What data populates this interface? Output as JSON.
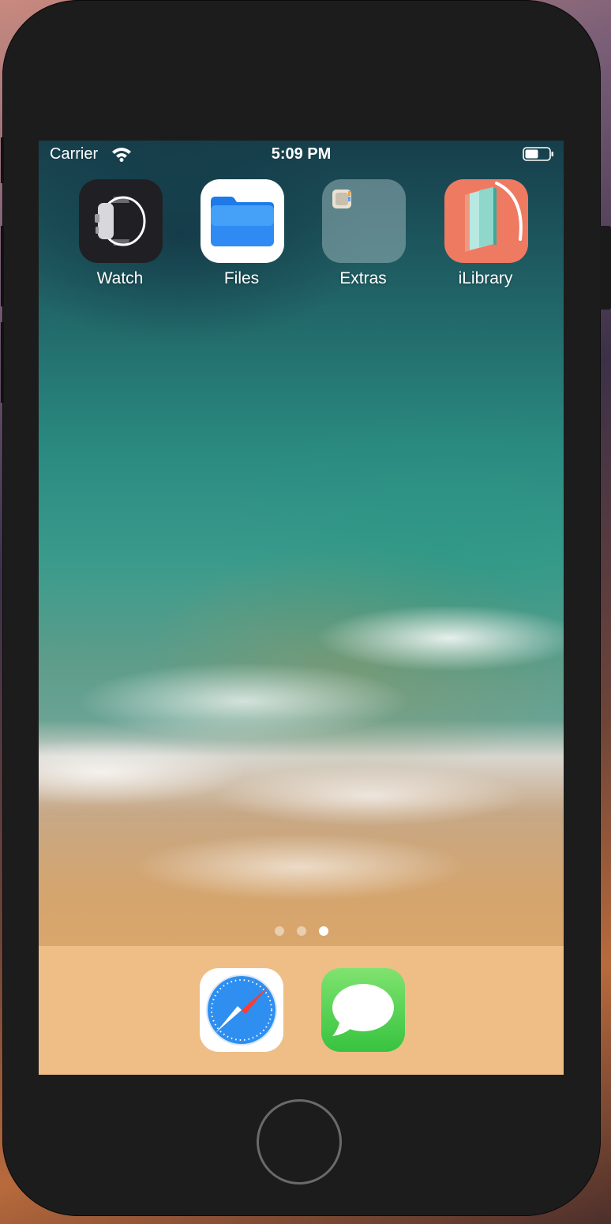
{
  "status_bar": {
    "carrier": "Carrier",
    "time": "5:09 PM",
    "wifi_icon": "wifi-icon",
    "battery_icon": "battery-icon"
  },
  "home_screen": {
    "apps": [
      {
        "label": "Watch",
        "icon": "watch-app-icon"
      },
      {
        "label": "Files",
        "icon": "files-app-icon"
      },
      {
        "label": "Extras",
        "icon": "folder-icon"
      },
      {
        "label": "iLibrary",
        "icon": "ilibrary-app-icon"
      }
    ],
    "page_count": 3,
    "current_page": 3
  },
  "dock": {
    "apps": [
      {
        "icon": "safari-app-icon"
      },
      {
        "icon": "messages-app-icon"
      }
    ]
  },
  "device": {
    "home_button_icon": "home-button-icon"
  }
}
